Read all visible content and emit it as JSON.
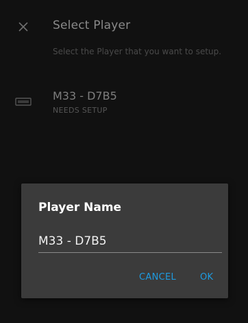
{
  "header": {
    "title": "Select Player",
    "subtitle": "Select the Player that you want to setup."
  },
  "players": [
    {
      "name": "M33 - D7B5",
      "status": "NEEDS SETUP",
      "icon": "speaker-device-icon"
    }
  ],
  "dialog": {
    "title": "Player Name",
    "input_value": "M33 - D7B5",
    "cancel_label": "CANCEL",
    "ok_label": "OK"
  },
  "colors": {
    "background": "#111111",
    "dialog_background": "#3b3b3b",
    "accent": "#1e9be0"
  }
}
